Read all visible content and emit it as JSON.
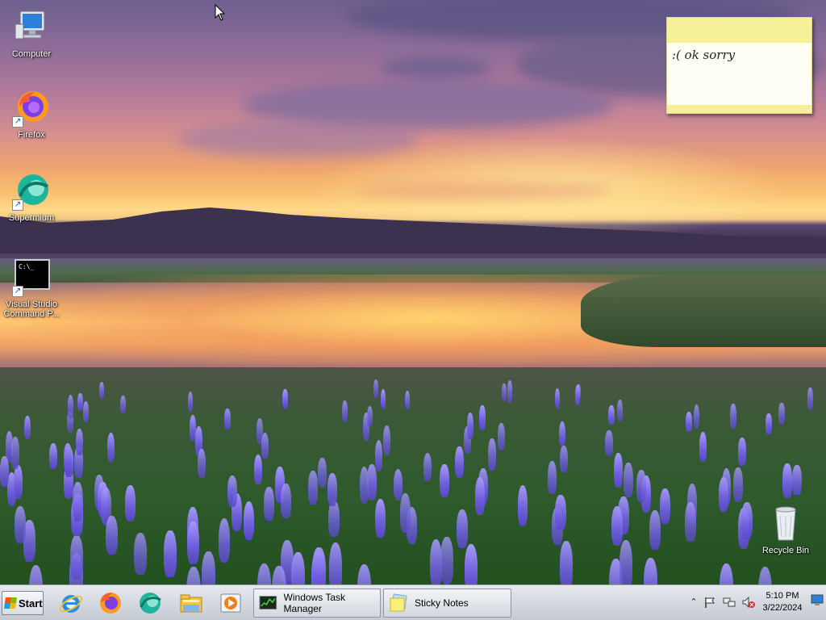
{
  "desktop": {
    "icons": [
      {
        "label": "Computer",
        "icon": "computer-icon"
      },
      {
        "label": "Firefox",
        "icon": "firefox-icon"
      },
      {
        "label": "Supermium",
        "icon": "supermium-icon"
      },
      {
        "label": "Visual Studio Command P...",
        "icon": "command-prompt-icon"
      },
      {
        "label": "Recycle Bin",
        "icon": "recycle-bin-icon"
      }
    ]
  },
  "sticky_note": {
    "text": ":( ok sorry"
  },
  "taskbar": {
    "start_label": "Start",
    "quick_launch": [
      "internet-explorer-icon",
      "firefox-icon",
      "supermium-icon",
      "file-explorer-icon",
      "media-player-icon"
    ],
    "buttons": [
      {
        "label": "Windows Task Manager",
        "icon": "task-manager-icon"
      },
      {
        "label": "Sticky Notes",
        "icon": "sticky-notes-icon"
      }
    ],
    "tray": {
      "icons": [
        "show-hidden-icons-chevron",
        "action-center-flag-icon",
        "network-icon",
        "volume-muted-icon"
      ],
      "time": "5:10 PM",
      "date": "3/22/2024"
    }
  },
  "colors": {
    "taskbar": "#d5d9e0",
    "sticky_bg": "#fdfbd0",
    "sticky_bar": "#f7f09a"
  }
}
